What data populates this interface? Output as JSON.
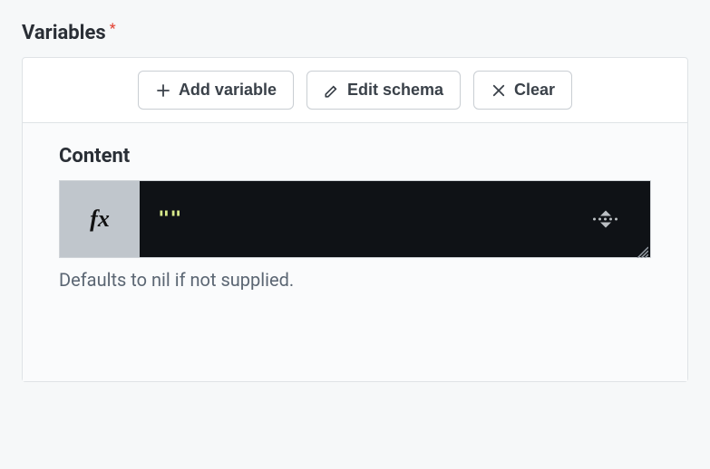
{
  "section": {
    "title": "Variables",
    "required_marker": "*"
  },
  "toolbar": {
    "add_variable": "Add variable",
    "edit_schema": "Edit schema",
    "clear": "Clear"
  },
  "field": {
    "label": "Content",
    "fx_label": "fx",
    "expression_value": "\"\"",
    "helper": "Defaults to nil if not supplied."
  }
}
